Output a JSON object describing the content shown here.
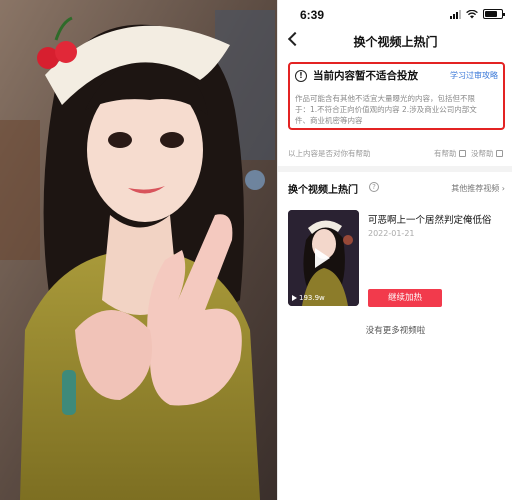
{
  "status_bar": {
    "time": "6:39"
  },
  "nav": {
    "title": "换个视频上热门"
  },
  "notice": {
    "title": "当前内容暂不适合投放",
    "link": "学习过审攻略",
    "body_line1": "作品可能含有其他不适宜大量曝光的内容，包括但不限",
    "body_line2": "于：1.不符合正向价值观的内容 2.涉及商业公司内部文",
    "body_line3": "件、商业机密等内容"
  },
  "feedback": {
    "question": "以上内容是否对你有帮助",
    "helpful": "有帮助",
    "not_helpful": "没帮助"
  },
  "section": {
    "title": "换个视频上热门",
    "other_link": "其他推荐视频 ›"
  },
  "video": {
    "title": "可恶啊上一个居然判定俺低俗",
    "date": "2022-01-21",
    "views": "193.9w",
    "boost_label": "继续加热"
  },
  "footer": {
    "no_more": "没有更多视频啦"
  },
  "colors": {
    "accent_red": "#f23a4c",
    "notice_border": "#e32323",
    "link_blue": "#3a78d8"
  },
  "icons": [
    "back-icon",
    "warning-icon",
    "thumbs-up-icon",
    "thumbs-down-icon",
    "info-icon",
    "play-icon",
    "views-icon",
    "wifi-icon",
    "battery-icon"
  ]
}
